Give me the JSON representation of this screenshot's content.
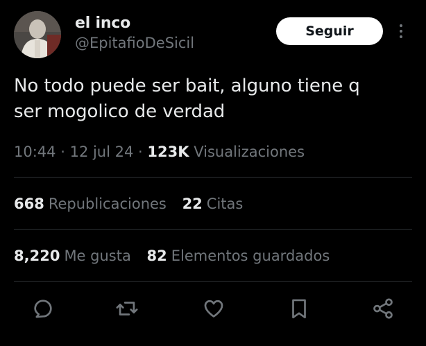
{
  "author": {
    "display_name": "el inco",
    "handle": "@EpitafioDeSicil"
  },
  "header": {
    "follow_label": "Seguir",
    "more_icon": "more-vertical-icon"
  },
  "tweet": {
    "line1": "No todo puede ser bait, alguno tiene q",
    "line2": "ser mogolico de verdad",
    "time": "10:44",
    "date": "12 jul 24",
    "views_count": "123K",
    "views_label": "Visualizaciones"
  },
  "stats": {
    "reposts_count": "668",
    "reposts_label": "Republicaciones",
    "quotes_count": "22",
    "quotes_label": "Citas",
    "likes_count": "8,220",
    "likes_label": "Me gusta",
    "bookmarks_count": "82",
    "bookmarks_label": "Elementos guardados"
  },
  "actions": [
    "reply-icon",
    "repost-icon",
    "like-icon",
    "bookmark-icon",
    "share-icon"
  ],
  "colors": {
    "background": "#000000",
    "primary_text": "#e7e9ea",
    "secondary_text": "#71767b",
    "divider": "#2f3336",
    "button_bg": "#ffffff"
  }
}
